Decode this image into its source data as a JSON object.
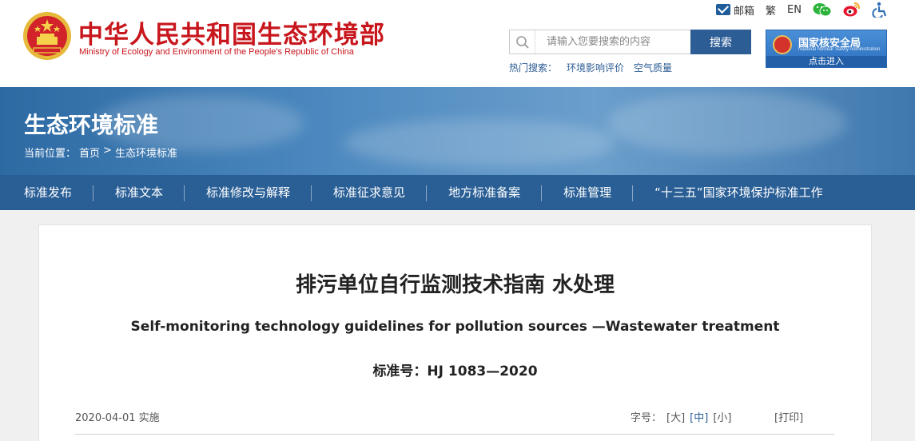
{
  "header": {
    "title_cn": "中华人民共和国生态环境部",
    "title_en": "Ministry of Ecology and Environment of the People's Republic of China",
    "topbar": {
      "mail": "邮箱",
      "traditional": "繁",
      "english": "EN"
    },
    "search": {
      "placeholder": "请输入您要搜索的内容",
      "button": "搜索"
    },
    "hot_search": {
      "label": "热门搜索：",
      "items": [
        "环境影响评价",
        "空气质量"
      ]
    },
    "nsa": {
      "title": "国家核安全局",
      "subtitle": "National Nuclear Safety Administration",
      "enter": "点击进入"
    }
  },
  "banner": {
    "title": "生态环境标准",
    "breadcrumb": {
      "label": "当前位置：",
      "home": "首页",
      "sep": ">",
      "current": "生态环境标准"
    }
  },
  "nav": {
    "items": [
      "标准发布",
      "标准文本",
      "标准修改与解释",
      "标准征求意见",
      "地方标准备案",
      "标准管理",
      "“十三五”国家环境保护标准工作"
    ]
  },
  "article": {
    "title_cn": "排污单位自行监测技术指南 水处理",
    "title_en": "Self-monitoring technology guidelines for pollution sources —Wastewater treatment",
    "code": "标准号：HJ 1083—2020",
    "date": "2020-04-01 实施",
    "font_label": "字号：",
    "font_large": "[大]",
    "font_medium": "[中]",
    "font_small": "[小]",
    "print": "[打印]"
  },
  "colors": {
    "brand_red": "#c8161d",
    "nav_blue": "#2a5f96",
    "search_blue": "#2d5d95"
  }
}
